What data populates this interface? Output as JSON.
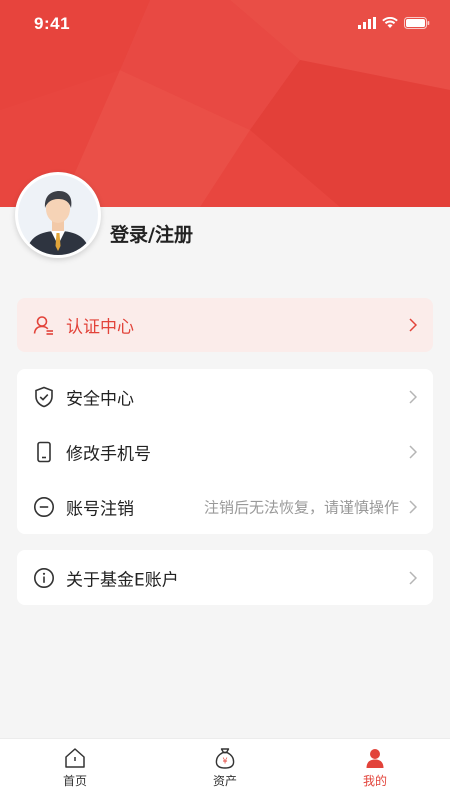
{
  "status_bar": {
    "time": "9:41"
  },
  "profile": {
    "login_text": "登录/注册"
  },
  "cert": {
    "label": "认证中心"
  },
  "menu": {
    "security": {
      "label": "安全中心"
    },
    "phone": {
      "label": "修改手机号"
    },
    "cancel": {
      "label": "账号注销",
      "hint": "注销后无法恢复，请谨慎操作"
    }
  },
  "about": {
    "label": "关于基金E账户"
  },
  "tabbar": {
    "home": {
      "label": "首页"
    },
    "assets": {
      "label": "资产"
    },
    "mine": {
      "label": "我的",
      "active": true
    }
  },
  "colors": {
    "brand_red": "#e8463f",
    "accent_text": "#e2433a"
  }
}
